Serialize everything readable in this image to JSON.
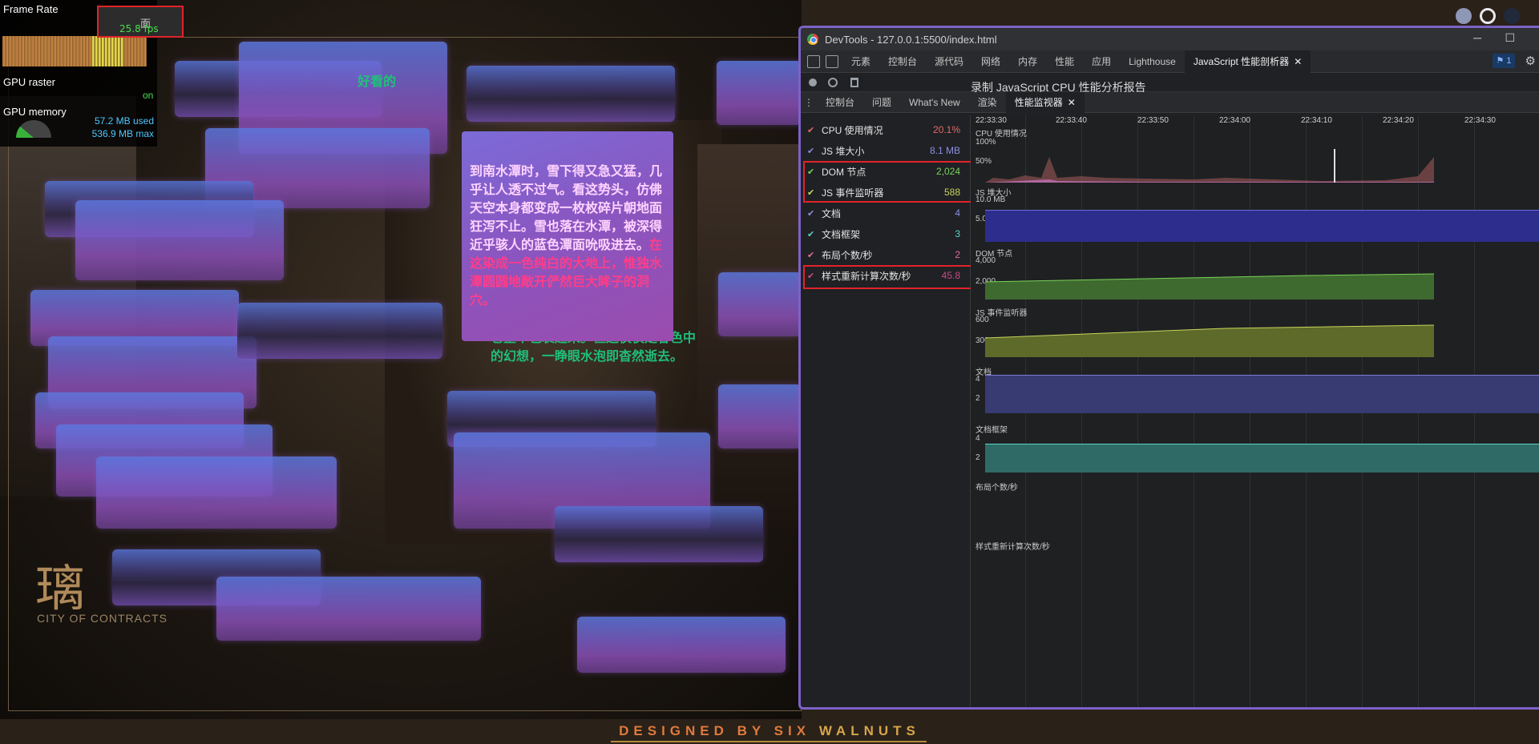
{
  "overlay": {
    "frame_rate_label": "Frame Rate",
    "fps_button_label": "面",
    "fps_value": "25.8 fps",
    "gpu_raster_label": "GPU raster",
    "gpu_raster_value": "on",
    "gpu_memory_label": "GPU memory",
    "gpu_memory_used": "57.2 MB used",
    "gpu_memory_max": "536.9 MB max"
  },
  "game": {
    "story_head": "好看的",
    "story_main_plain": "到南水潭时，雪下得又急又猛，几乎让人透不过气。看这势头，仿佛天空本身都变成一枚枚碎片朝地面狂泻不止。雪也落在水潭，被深得近乎骇人的蓝色潭面吮吸进去。",
    "story_main_highlight": "在这染成一色纯白的大地上，惟独水潭圆圆地敞开俨然巨大眸子的洞穴。",
    "story_green": "它整个包裹起来。但这仅仅是暮色中的幻想，一睁眼水泡即杳然逝去。",
    "logo_cn": "璃",
    "logo_en": "CITY OF CONTRACTS",
    "colors": {
      "accent_purple": "#8a4fb6",
      "accent_blue": "#5d78e0"
    }
  },
  "footer": {
    "prefix": "DESIGNED BY SIX",
    "highlight": "WALNUTS"
  },
  "devtools": {
    "title": "DevTools - 127.0.0.1:5500/index.html",
    "main_tabs": [
      {
        "label": "元素"
      },
      {
        "label": "控制台"
      },
      {
        "label": "源代码"
      },
      {
        "label": "网络"
      },
      {
        "label": "内存"
      },
      {
        "label": "性能"
      },
      {
        "label": "应用"
      },
      {
        "label": "Lighthouse"
      },
      {
        "label": "JavaScript 性能剖析器"
      }
    ],
    "issues_badge": "1",
    "report_title": "录制 JavaScript CPU 性能分析报告",
    "drawer_tabs": [
      {
        "label": "控制台"
      },
      {
        "label": "问题"
      },
      {
        "label": "What's New"
      },
      {
        "label": "渲染"
      },
      {
        "label": "性能监视器"
      }
    ],
    "metrics": [
      {
        "label": "CPU 使用情况",
        "value": "20.1%",
        "color": "#e46a6a"
      },
      {
        "label": "JS 堆大小",
        "value": "8.1 MB",
        "color": "#8b8fe0"
      },
      {
        "label": "DOM 节点",
        "value": "2,024",
        "color": "#79d35a"
      },
      {
        "label": "JS 事件监听器",
        "value": "588",
        "color": "#c9d45a"
      },
      {
        "label": "文档",
        "value": "4",
        "color": "#8b8fe0"
      },
      {
        "label": "文档框架",
        "value": "3",
        "color": "#5ad3c9"
      },
      {
        "label": "布局个数/秒",
        "value": "2",
        "color": "#e46aa0"
      },
      {
        "label": "样式重新计算次数/秒",
        "value": "45.8",
        "color": "#c94a8a"
      }
    ],
    "time_ticks": [
      "22:33:30",
      "22:33:40",
      "22:33:50",
      "22:34:00",
      "22:34:10",
      "22:34:20",
      "22:34:30"
    ],
    "charts": {
      "cpu": {
        "label": "CPU 使用情况",
        "y_top": "100%",
        "y_mid": "50%"
      },
      "heap": {
        "label": "JS 堆大小",
        "y_top": "10.0 MB",
        "y_mid": "5.0 MB"
      },
      "dom": {
        "label": "DOM 节点",
        "y_top": "4,000",
        "y_mid": "2,000"
      },
      "listeners": {
        "label": "JS 事件监听器",
        "y_top": "600",
        "y_mid": "300"
      },
      "docs": {
        "label": "文档",
        "y_top": "4",
        "y_mid": "2"
      },
      "frames": {
        "label": "文档框架",
        "y_top": "4",
        "y_mid": "2"
      },
      "layouts": {
        "label": "布局个数/秒"
      },
      "style": {
        "label": "样式重新计算次数/秒"
      }
    }
  }
}
